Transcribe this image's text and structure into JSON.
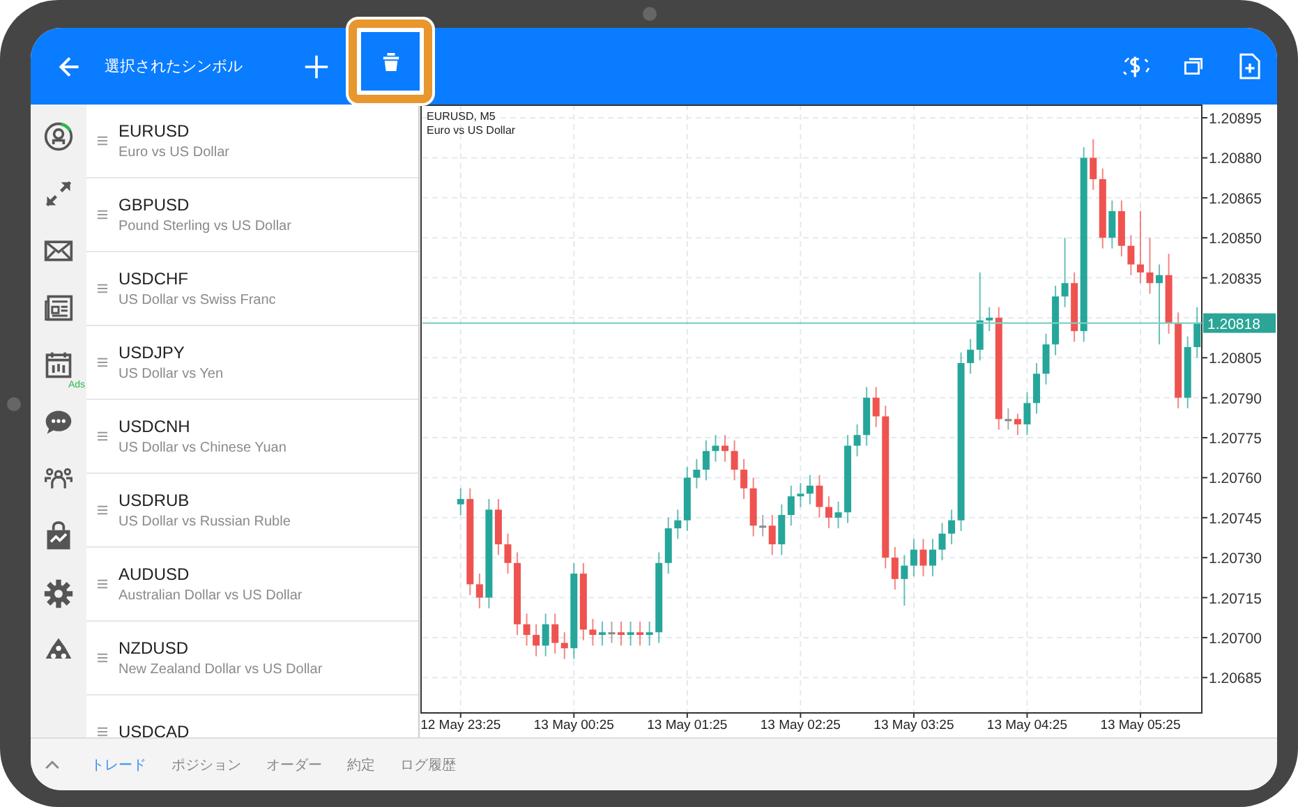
{
  "header": {
    "title": "選択されたシンボル"
  },
  "sidebar": {
    "ads_label": "Ads"
  },
  "symbols": [
    {
      "name": "EURUSD",
      "description": "Euro vs US Dollar"
    },
    {
      "name": "GBPUSD",
      "description": "Pound Sterling vs US Dollar"
    },
    {
      "name": "USDCHF",
      "description": "US Dollar vs Swiss Franc"
    },
    {
      "name": "USDJPY",
      "description": "US Dollar vs Yen"
    },
    {
      "name": "USDCNH",
      "description": "US Dollar vs Chinese Yuan"
    },
    {
      "name": "USDRUB",
      "description": "US Dollar vs Russian Ruble"
    },
    {
      "name": "AUDUSD",
      "description": "Australian Dollar vs US Dollar"
    },
    {
      "name": "NZDUSD",
      "description": "New Zealand Dollar vs US Dollar"
    },
    {
      "name": "USDCAD"
    }
  ],
  "chart": {
    "symbol_label": "EURUSD, M5",
    "description": "Euro vs US Dollar",
    "chart_data": {
      "type": "candlestick",
      "categories": [
        "12 May 23:25",
        null,
        null,
        null,
        null,
        null,
        null,
        null,
        null,
        null,
        null,
        null,
        "13 May 00:25",
        null,
        null,
        null,
        null,
        null,
        null,
        null,
        null,
        null,
        null,
        null,
        "13 May 01:25",
        null,
        null,
        null,
        null,
        null,
        null,
        null,
        null,
        null,
        null,
        null,
        "13 May 02:25",
        null,
        null,
        null,
        null,
        null,
        null,
        null,
        null,
        null,
        null,
        null,
        "13 May 03:25",
        null,
        null,
        null,
        null,
        null,
        null,
        null,
        null,
        null,
        null,
        null,
        "13 May 04:25",
        null,
        null,
        null,
        null,
        null,
        null,
        null,
        null,
        null,
        null,
        null,
        "13 May 05:25",
        null,
        null,
        null,
        null,
        null,
        null
      ],
      "ylim": [
        1.20672,
        1.209
      ],
      "grid": true,
      "ref_lines": [
        {
          "axis": "y",
          "value": 1.20818,
          "label": "1.20818"
        }
      ],
      "ohlc": [
        [
          1.2075,
          1.20756,
          1.20746,
          1.20752
        ],
        [
          1.20752,
          1.20756,
          1.20716,
          1.2072
        ],
        [
          1.2072,
          1.20724,
          1.20711,
          1.20715
        ],
        [
          1.20715,
          1.20752,
          1.20711,
          1.20748
        ],
        [
          1.20748,
          1.20752,
          1.20731,
          1.20735
        ],
        [
          1.20735,
          1.20739,
          1.20724,
          1.20728
        ],
        [
          1.20728,
          1.20732,
          1.20701,
          1.20705
        ],
        [
          1.20705,
          1.20709,
          1.20697,
          1.20701
        ],
        [
          1.20701,
          1.20705,
          1.20693,
          1.20697
        ],
        [
          1.20697,
          1.20709,
          1.20693,
          1.20705
        ],
        [
          1.20705,
          1.20709,
          1.20694,
          1.20698
        ],
        [
          1.20698,
          1.20702,
          1.20692,
          1.20696
        ],
        [
          1.20696,
          1.20728,
          1.20692,
          1.20724
        ],
        [
          1.20724,
          1.20728,
          1.20699,
          1.20703
        ],
        [
          1.20703,
          1.20707,
          1.20697,
          1.20701
        ],
        [
          1.20701,
          1.20706,
          1.20697,
          1.20702
        ],
        [
          1.20702,
          1.20706,
          1.20698,
          1.20702
        ],
        [
          1.20702,
          1.20706,
          1.20697,
          1.20701
        ],
        [
          1.20701,
          1.20706,
          1.20697,
          1.20702
        ],
        [
          1.20702,
          1.20706,
          1.20697,
          1.20701
        ],
        [
          1.20701,
          1.20706,
          1.20697,
          1.20702
        ],
        [
          1.20702,
          1.20732,
          1.20698,
          1.20728
        ],
        [
          1.20728,
          1.20745,
          1.20724,
          1.20741
        ],
        [
          1.20741,
          1.20748,
          1.20737,
          1.20744
        ],
        [
          1.20744,
          1.20764,
          1.2074,
          1.2076
        ],
        [
          1.2076,
          1.20767,
          1.20756,
          1.20763
        ],
        [
          1.20763,
          1.20774,
          1.20759,
          1.2077
        ],
        [
          1.2077,
          1.20776,
          1.20766,
          1.20772
        ],
        [
          1.20772,
          1.20776,
          1.20766,
          1.2077
        ],
        [
          1.2077,
          1.20774,
          1.20759,
          1.20763
        ],
        [
          1.20763,
          1.20767,
          1.20752,
          1.20756
        ],
        [
          1.20756,
          1.2076,
          1.20738,
          1.20742
        ],
        [
          1.20742,
          1.20746,
          1.20738,
          1.20742
        ],
        [
          1.20742,
          1.20746,
          1.20731,
          1.20735
        ],
        [
          1.20735,
          1.2075,
          1.20731,
          1.20746
        ],
        [
          1.20746,
          1.20757,
          1.20742,
          1.20753
        ],
        [
          1.20753,
          1.20758,
          1.20749,
          1.20754
        ],
        [
          1.20754,
          1.20761,
          1.2075,
          1.20757
        ],
        [
          1.20757,
          1.20761,
          1.20745,
          1.20749
        ],
        [
          1.20749,
          1.20753,
          1.20741,
          1.20745
        ],
        [
          1.20745,
          1.20751,
          1.20741,
          1.20747
        ],
        [
          1.20747,
          1.20776,
          1.20743,
          1.20772
        ],
        [
          1.20772,
          1.2078,
          1.20768,
          1.20776
        ],
        [
          1.20776,
          1.20794,
          1.20772,
          1.2079
        ],
        [
          1.2079,
          1.20794,
          1.20779,
          1.20783
        ],
        [
          1.20783,
          1.20787,
          1.20726,
          1.2073
        ],
        [
          1.2073,
          1.20734,
          1.20718,
          1.20722
        ],
        [
          1.20722,
          1.20731,
          1.20712,
          1.20727
        ],
        [
          1.20727,
          1.20737,
          1.20723,
          1.20733
        ],
        [
          1.20733,
          1.20737,
          1.20723,
          1.20727
        ],
        [
          1.20727,
          1.20737,
          1.20723,
          1.20733
        ],
        [
          1.20733,
          1.20743,
          1.20729,
          1.20739
        ],
        [
          1.20739,
          1.20748,
          1.20735,
          1.20744
        ],
        [
          1.20744,
          1.20807,
          1.2074,
          1.20803
        ],
        [
          1.20803,
          1.20812,
          1.20799,
          1.20808
        ],
        [
          1.20808,
          1.20837,
          1.20804,
          1.20819
        ],
        [
          1.20819,
          1.20824,
          1.20815,
          1.2082
        ],
        [
          1.2082,
          1.20824,
          1.20778,
          1.20782
        ],
        [
          1.20782,
          1.20786,
          1.20778,
          1.20782
        ],
        [
          1.20782,
          1.20784,
          1.20776,
          1.2078
        ],
        [
          1.2078,
          1.20792,
          1.20776,
          1.20788
        ],
        [
          1.20788,
          1.20803,
          1.20784,
          1.20799
        ],
        [
          1.20799,
          1.20814,
          1.20795,
          1.2081
        ],
        [
          1.2081,
          1.20832,
          1.20806,
          1.20828
        ],
        [
          1.20828,
          1.2085,
          1.20824,
          1.20833
        ],
        [
          1.20833,
          1.20837,
          1.20811,
          1.20815
        ],
        [
          1.20815,
          1.20884,
          1.20811,
          1.2088
        ],
        [
          1.2088,
          1.20887,
          1.20868,
          1.20872
        ],
        [
          1.20872,
          1.20876,
          1.20846,
          1.2085
        ],
        [
          1.2085,
          1.20864,
          1.20846,
          1.2086
        ],
        [
          1.2086,
          1.20864,
          1.20843,
          1.20847
        ],
        [
          1.20847,
          1.20851,
          1.20836,
          1.2084
        ],
        [
          1.2084,
          1.2086,
          1.20833,
          1.20837
        ],
        [
          1.20837,
          1.2085,
          1.20829,
          1.20833
        ],
        [
          1.20833,
          1.2084,
          1.2081,
          1.20836
        ],
        [
          1.20836,
          1.20844,
          1.20814,
          1.20818
        ],
        [
          1.20818,
          1.20822,
          1.20786,
          1.2079
        ],
        [
          1.2079,
          1.20813,
          1.20786,
          1.20809
        ],
        [
          1.20809,
          1.20824,
          1.20805,
          1.20818
        ]
      ],
      "yticks": [
        {
          "value": 1.20895,
          "label": "1.20895"
        },
        {
          "value": 1.2088,
          "label": "1.20880"
        },
        {
          "value": 1.20865,
          "label": "1.20865"
        },
        {
          "value": 1.2085,
          "label": "1.20850"
        },
        {
          "value": 1.20835,
          "label": "1.20835"
        },
        {
          "value": 1.20805,
          "label": "1.20805"
        },
        {
          "value": 1.2079,
          "label": "1.20790"
        },
        {
          "value": 1.20775,
          "label": "1.20775"
        },
        {
          "value": 1.2076,
          "label": "1.20760"
        },
        {
          "value": 1.20745,
          "label": "1.20745"
        },
        {
          "value": 1.2073,
          "label": "1.20730"
        },
        {
          "value": 1.20715,
          "label": "1.20715"
        },
        {
          "value": 1.207,
          "label": "1.20700"
        },
        {
          "value": 1.20685,
          "label": "1.20685"
        }
      ]
    }
  },
  "bottom_tabs": [
    {
      "label": "トレード",
      "selected": true
    },
    {
      "label": "ポジション",
      "selected": false
    },
    {
      "label": "オーダー",
      "selected": false
    },
    {
      "label": "約定",
      "selected": false
    },
    {
      "label": "ログ履歴",
      "selected": false
    }
  ]
}
